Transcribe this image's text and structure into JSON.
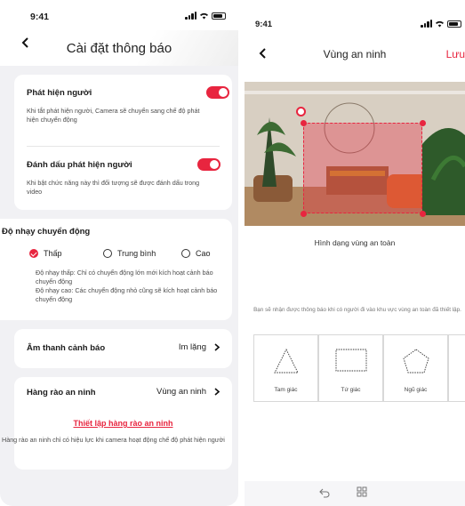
{
  "status": {
    "time": "9:41"
  },
  "left": {
    "title": "Cài đặt thông báo",
    "person_detect": {
      "title": "Phát hiện người",
      "desc": "Khi tắt phát hiện người, Camera sẽ chuyển sang chế độ phát hiện chuyển động",
      "enabled": true
    },
    "person_mark": {
      "title": "Đánh dấu phát hiện người",
      "desc": "Khi bật chức năng này thì đối tượng sẽ được đánh dấu trong video",
      "enabled": true
    },
    "sensitivity": {
      "title": "Độ nhạy chuyển động",
      "options": [
        "Thấp",
        "Trung bình",
        "Cao"
      ],
      "selected": "Thấp",
      "desc_low": "Độ nhạy thấp: Chỉ có chuyển động lớn mới kích hoạt cảnh báo chuyển động",
      "desc_high": "Độ nhạy cao: Các chuyển động nhỏ cũng sẽ kích hoạt cảnh báo chuyển động"
    },
    "alarm_sound": {
      "label": "Âm thanh cảnh báo",
      "value": "Im lặng"
    },
    "fence": {
      "label": "Hàng rào an ninh",
      "value": "Vùng an ninh",
      "setup_link": "Thiết lập hàng rào an ninh",
      "note": "Hàng rào an ninh chỉ có hiệu lực khi camera hoạt động chế độ phát hiện người"
    }
  },
  "right": {
    "title": "Vùng an ninh",
    "save": "Lưu",
    "shape_label": "Hình dạng vùng an toàn",
    "info": "Bạn sẽ nhận được thông báo khi có người đi vào khu vực vùng an toàn đã thiết lập.",
    "shapes": [
      "Tam giác",
      "Tứ giác",
      "Ngũ giác"
    ]
  },
  "colors": {
    "accent": "#e8253f"
  }
}
